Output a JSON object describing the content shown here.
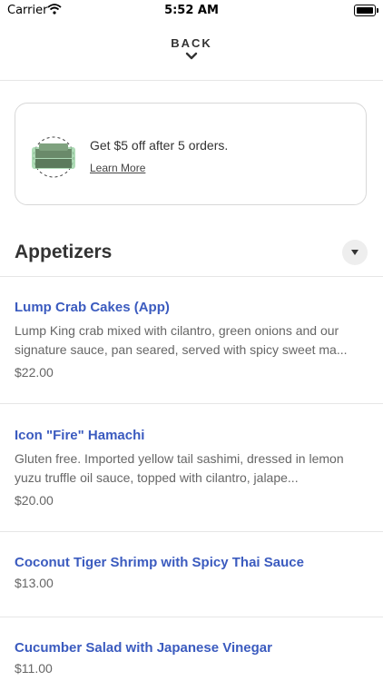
{
  "status_bar": {
    "carrier": "Carrier",
    "time": "5:52 AM"
  },
  "header": {
    "back_label": "BACK"
  },
  "promo": {
    "text": "Get $5 off after 5 orders.",
    "link": "Learn More",
    "icon": "bento-box-icon"
  },
  "section": {
    "title": "Appetizers"
  },
  "items": [
    {
      "name": "Lump Crab Cakes (App)",
      "description": "Lump King crab mixed with cilantro, green onions and our signature sauce, pan seared, served with spicy sweet ma...",
      "price": "$22.00"
    },
    {
      "name": "Icon \"Fire\" Hamachi",
      "description": "Gluten free. Imported yellow tail sashimi, dressed in lemon yuzu truffle oil sauce, topped with cilantro, jalape...",
      "price": "$20.00"
    },
    {
      "name": "Coconut Tiger Shrimp with Spicy Thai Sauce",
      "description": "",
      "price": "$13.00"
    },
    {
      "name": "Cucumber Salad with Japanese Vinegar",
      "description": "",
      "price": "$11.00"
    }
  ],
  "colors": {
    "link": "#3b5bbf",
    "promo_green": "#6abf7a"
  }
}
